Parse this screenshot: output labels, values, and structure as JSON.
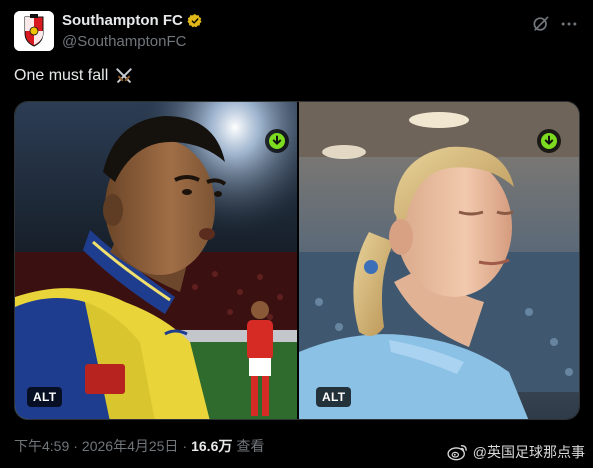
{
  "header": {
    "display_name": "Southampton FC",
    "handle": "@SouthamptonFC"
  },
  "post": {
    "text": "One must fall",
    "emoji": "crossed-swords-emoji"
  },
  "media": {
    "alt_left": "ALT",
    "alt_right": "ALT"
  },
  "meta": {
    "time": "下午4:59",
    "date": "2026年4月25日",
    "views_count": "16.6万",
    "views_label": "查看"
  },
  "watermark": {
    "text": "@英国足球那点事"
  },
  "colors": {
    "background": "#000000",
    "text_primary": "#e7e9ea",
    "text_secondary": "#71767b",
    "verified_gold": "#e2b719",
    "download_green": "#7ddc1f"
  },
  "icons": [
    "verified-badge-icon",
    "grok-icon",
    "more-icon",
    "download-icon",
    "weibo-icon"
  ]
}
